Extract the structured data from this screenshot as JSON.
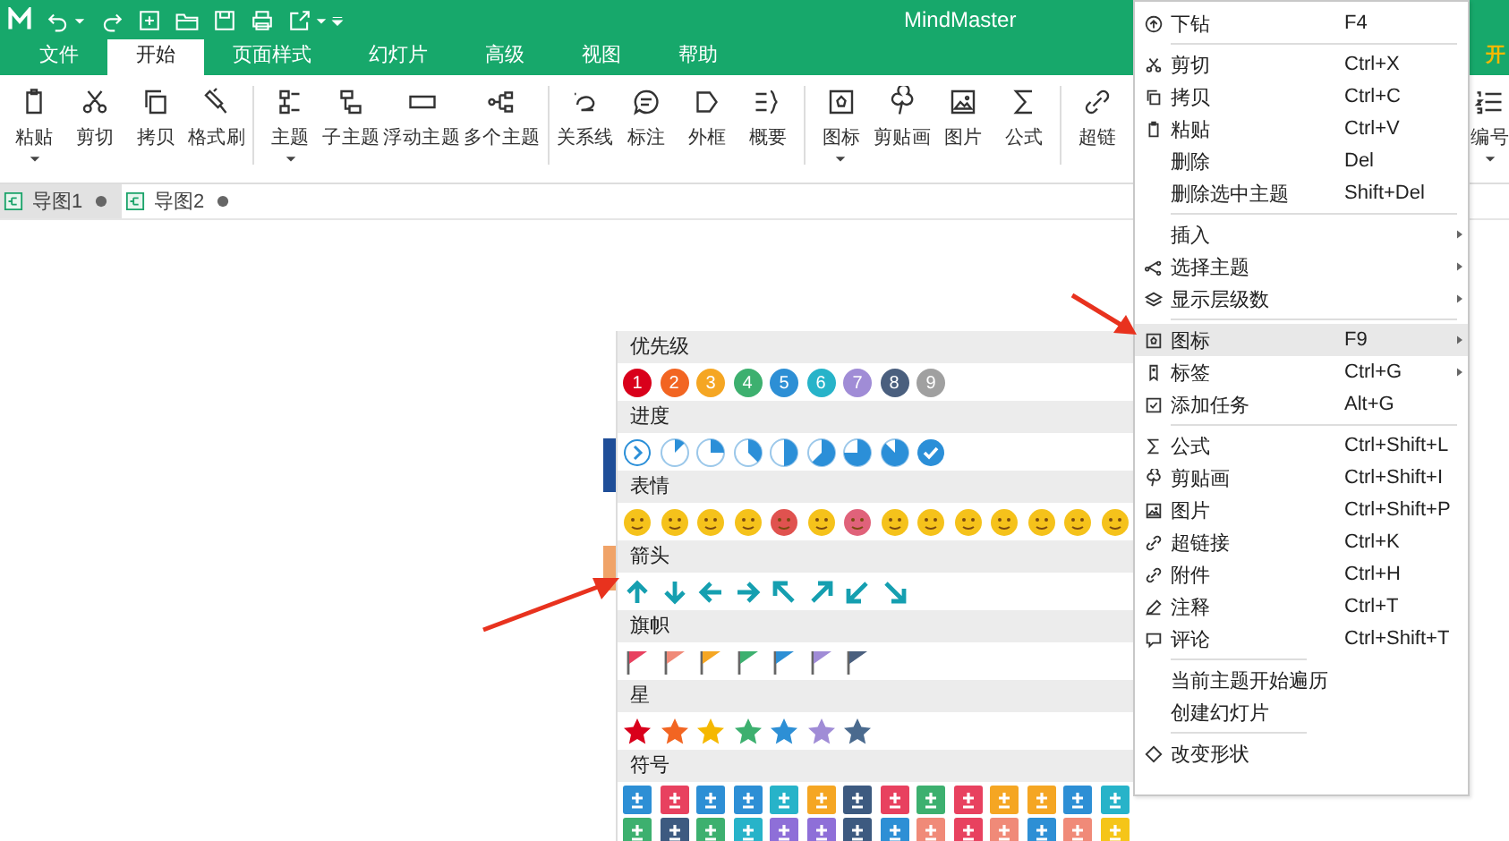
{
  "app": {
    "title": "MindMaster",
    "right_tab_fragment": "开"
  },
  "menu_tabs": [
    {
      "label": "文件",
      "selected": false
    },
    {
      "label": "开始",
      "selected": true
    },
    {
      "label": "页面样式",
      "selected": false
    },
    {
      "label": "幻灯片",
      "selected": false
    },
    {
      "label": "高级",
      "selected": false
    },
    {
      "label": "视图",
      "selected": false
    },
    {
      "label": "帮助",
      "selected": false
    }
  ],
  "ribbon": [
    [
      {
        "label": "粘贴",
        "dropdown": true
      },
      {
        "label": "剪切",
        "dropdown": false
      },
      {
        "label": "拷贝",
        "dropdown": false
      },
      {
        "label": "格式刷",
        "dropdown": false
      }
    ],
    [
      {
        "label": "主题",
        "dropdown": true
      },
      {
        "label": "子主题",
        "dropdown": false
      },
      {
        "label": "浮动主题",
        "dropdown": false
      },
      {
        "label": "多个主题",
        "dropdown": false
      }
    ],
    [
      {
        "label": "关系线",
        "dropdown": false
      },
      {
        "label": "标注",
        "dropdown": false
      },
      {
        "label": "外框",
        "dropdown": false
      },
      {
        "label": "概要",
        "dropdown": false
      }
    ],
    [
      {
        "label": "图标",
        "dropdown": true
      },
      {
        "label": "剪贴画",
        "dropdown": false
      },
      {
        "label": "图片",
        "dropdown": false
      },
      {
        "label": "公式",
        "dropdown": false
      }
    ],
    [
      {
        "label": "超链",
        "dropdown": false
      }
    ]
  ],
  "ribbon_right": {
    "label": "编号",
    "dropdown": true
  },
  "doc_tabs": [
    {
      "label": "导图1",
      "selected": true
    },
    {
      "label": "导图2",
      "selected": false
    }
  ],
  "icon_panel": [
    {
      "title": "优先级",
      "kind": "priority",
      "items": [
        {
          "text": "1",
          "color": "#d9001b"
        },
        {
          "text": "2",
          "color": "#f26522"
        },
        {
          "text": "3",
          "color": "#f5a623"
        },
        {
          "text": "4",
          "color": "#3db06f"
        },
        {
          "text": "5",
          "color": "#2d8fd5"
        },
        {
          "text": "6",
          "color": "#27b3c9"
        },
        {
          "text": "7",
          "color": "#a08cd6"
        },
        {
          "text": "8",
          "color": "#4a5f7e"
        },
        {
          "text": "9",
          "color": "#a0a0a0"
        }
      ]
    },
    {
      "title": "进度",
      "kind": "progress",
      "items": [
        {
          "kind": "start"
        },
        {
          "kind": "one-eighth"
        },
        {
          "kind": "one-quarter"
        },
        {
          "kind": "three-eighths"
        },
        {
          "kind": "half"
        },
        {
          "kind": "five-eighths"
        },
        {
          "kind": "three-quarters"
        },
        {
          "kind": "seven-eighths"
        },
        {
          "kind": "done"
        }
      ]
    },
    {
      "title": "表情",
      "kind": "emoji",
      "items": [
        {
          "color": "#f5c21b"
        },
        {
          "color": "#f5c21b"
        },
        {
          "color": "#f5c21b"
        },
        {
          "color": "#f5c21b"
        },
        {
          "color": "#e0524f"
        },
        {
          "color": "#f5c21b"
        },
        {
          "color": "#e0627a"
        },
        {
          "color": "#f5c21b"
        },
        {
          "color": "#f5c21b"
        },
        {
          "color": "#f5c21b"
        },
        {
          "color": "#f5c21b"
        },
        {
          "color": "#f5c21b"
        },
        {
          "color": "#f5c21b"
        },
        {
          "color": "#f5c21b"
        }
      ]
    },
    {
      "title": "箭头",
      "kind": "arrow",
      "items": [
        {
          "kind": "up"
        },
        {
          "kind": "down"
        },
        {
          "kind": "left"
        },
        {
          "kind": "right"
        },
        {
          "kind": "up-left"
        },
        {
          "kind": "up-right"
        },
        {
          "kind": "down-left"
        },
        {
          "kind": "down-right"
        }
      ]
    },
    {
      "title": "旗帜",
      "kind": "flag",
      "items": [
        {
          "color": "#e8415f"
        },
        {
          "color": "#f08a78"
        },
        {
          "color": "#f5a623"
        },
        {
          "color": "#3db06f"
        },
        {
          "color": "#2d8fd5"
        },
        {
          "color": "#a08cd6"
        },
        {
          "color": "#4a5f7e"
        }
      ]
    },
    {
      "title": "星",
      "kind": "star",
      "items": [
        {
          "color": "#d9001b"
        },
        {
          "color": "#f26522"
        },
        {
          "color": "#f5b800"
        },
        {
          "color": "#3db06f"
        },
        {
          "color": "#2d8fd5"
        },
        {
          "color": "#a08cd6"
        },
        {
          "color": "#4a6a8e"
        }
      ]
    },
    {
      "title": "符号",
      "kind": "symbol",
      "items": [
        {
          "color": "#2d8fd5"
        },
        {
          "color": "#e8415f"
        },
        {
          "color": "#2d8fd5"
        },
        {
          "color": "#2d8fd5"
        },
        {
          "color": "#27b3c9"
        },
        {
          "color": "#f5a623"
        },
        {
          "color": "#3d5a80"
        },
        {
          "color": "#e8415f"
        },
        {
          "color": "#3db06f"
        },
        {
          "color": "#e8415f"
        },
        {
          "color": "#f5a623"
        },
        {
          "color": "#f5a623"
        },
        {
          "color": "#2d8fd5"
        },
        {
          "color": "#27b3c9"
        },
        {
          "color": "#3db06f"
        },
        {
          "color": "#3d5a80"
        },
        {
          "color": "#3db06f"
        },
        {
          "color": "#27b3c9"
        },
        {
          "color": "#8e6fd8"
        },
        {
          "color": "#8e6fd8"
        },
        {
          "color": "#3d5a80"
        },
        {
          "color": "#2d8fd5"
        },
        {
          "color": "#f08a78"
        },
        {
          "color": "#e8415f"
        },
        {
          "color": "#f08a78"
        },
        {
          "color": "#2d8fd5"
        },
        {
          "color": "#f08a78"
        },
        {
          "color": "#f5c518"
        }
      ]
    }
  ],
  "context_menu": [
    [
      {
        "label": "下钻",
        "shortcut": "F4",
        "submenu": false,
        "selected": false
      }
    ],
    [
      {
        "label": "剪切",
        "shortcut": "Ctrl+X",
        "submenu": false,
        "selected": false
      },
      {
        "label": "拷贝",
        "shortcut": "Ctrl+C",
        "submenu": false,
        "selected": false
      },
      {
        "label": "粘贴",
        "shortcut": "Ctrl+V",
        "submenu": false,
        "selected": false
      },
      {
        "label": "删除",
        "shortcut": "Del",
        "submenu": false,
        "selected": false
      },
      {
        "label": "删除选中主题",
        "shortcut": "Shift+Del",
        "submenu": false,
        "selected": false
      }
    ],
    [
      {
        "label": "插入",
        "submenu": true,
        "selected": false
      },
      {
        "label": "选择主题",
        "submenu": true,
        "selected": false
      },
      {
        "label": "显示层级数",
        "submenu": true,
        "selected": false
      }
    ],
    [
      {
        "label": "图标",
        "shortcut": "F9",
        "submenu": true,
        "selected": true
      },
      {
        "label": "标签",
        "shortcut": "Ctrl+G",
        "submenu": true,
        "selected": false
      },
      {
        "label": "添加任务",
        "shortcut": "Alt+G",
        "submenu": false,
        "selected": false
      }
    ],
    [
      {
        "label": "公式",
        "shortcut": "Ctrl+Shift+L",
        "submenu": false,
        "selected": false
      },
      {
        "label": "剪贴画",
        "shortcut": "Ctrl+Shift+I",
        "submenu": false,
        "selected": false
      },
      {
        "label": "图片",
        "shortcut": "Ctrl+Shift+P",
        "submenu": false,
        "selected": false
      },
      {
        "label": "超链接",
        "shortcut": "Ctrl+K",
        "submenu": false,
        "selected": false
      },
      {
        "label": "附件",
        "shortcut": "Ctrl+H",
        "submenu": false,
        "selected": false
      },
      {
        "label": "注释",
        "shortcut": "Ctrl+T",
        "submenu": false,
        "selected": false
      },
      {
        "label": "评论",
        "shortcut": "Ctrl+Shift+T",
        "submenu": false,
        "selected": false
      }
    ],
    [
      {
        "label": "当前主题开始遍历",
        "submenu": false,
        "selected": false
      },
      {
        "label": "创建幻灯片",
        "submenu": false,
        "selected": false
      }
    ],
    [
      {
        "label": "改变形状",
        "submenu": false,
        "selected": false
      }
    ]
  ]
}
